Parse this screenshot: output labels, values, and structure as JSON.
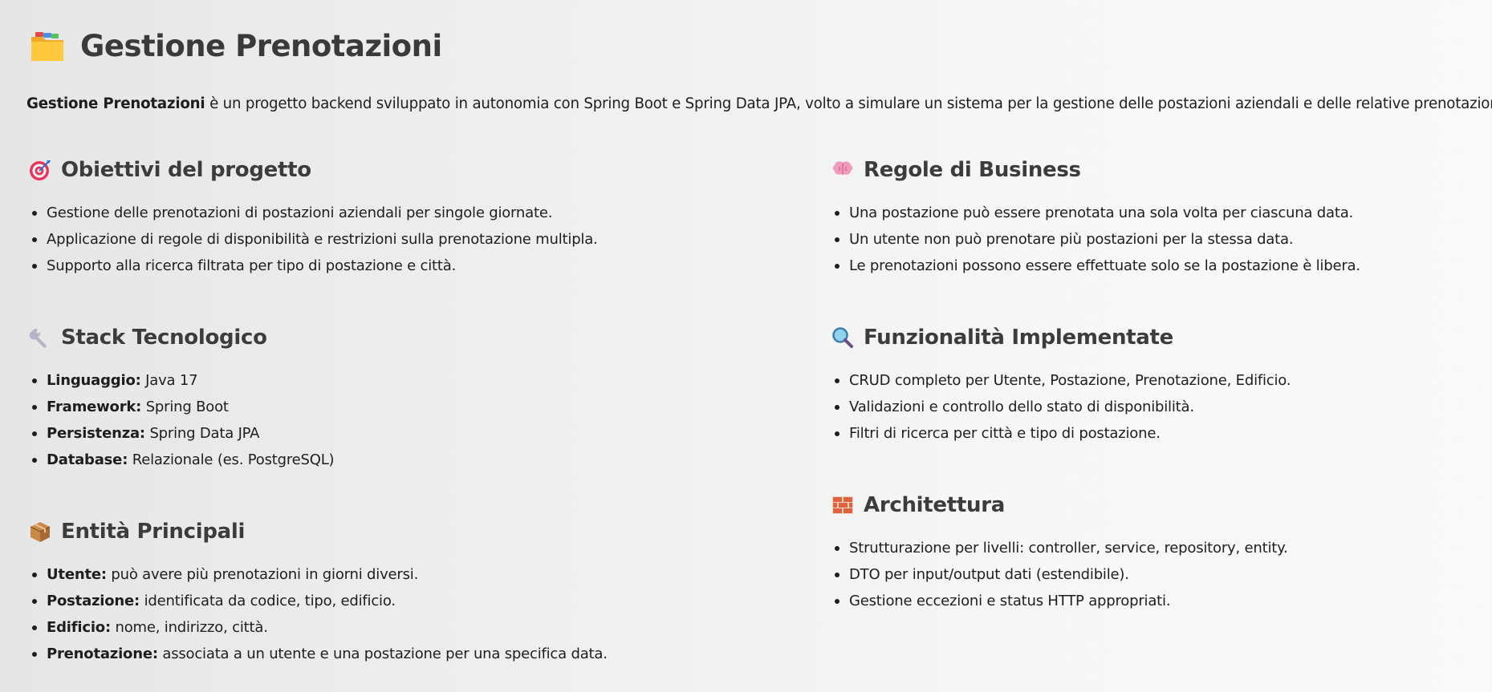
{
  "title": {
    "text": "Gestione Prenotazioni",
    "icon": "file-folder-icon"
  },
  "intro": {
    "bold": "Gestione Prenotazioni",
    "text": " è un progetto backend sviluppato in autonomia con Spring Boot e Spring Data JPA, volto a simulare un sistema per la gestione delle postazioni aziendali e delle relative prenotazioni."
  },
  "sections": {
    "obiettivi": {
      "icon": "target-icon",
      "heading": "Obiettivi del progetto",
      "items": [
        "Gestione delle prenotazioni di postazioni aziendali per singole giornate.",
        "Applicazione di regole di disponibilità e restrizioni sulla prenotazione multipla.",
        "Supporto alla ricerca filtrata per tipo di postazione e città."
      ]
    },
    "stack": {
      "icon": "wrench-icon",
      "heading": "Stack Tecnologico",
      "items": [
        {
          "label": "Linguaggio:",
          "value": " Java 17"
        },
        {
          "label": "Framework:",
          "value": " Spring Boot"
        },
        {
          "label": "Persistenza:",
          "value": " Spring Data JPA"
        },
        {
          "label": "Database:",
          "value": " Relazionale (es. PostgreSQL)"
        }
      ]
    },
    "entita": {
      "icon": "package-icon",
      "heading": "Entità Principali",
      "items": [
        {
          "label": "Utente:",
          "value": " può avere più prenotazioni in giorni diversi."
        },
        {
          "label": "Postazione:",
          "value": " identificata da codice, tipo, edificio."
        },
        {
          "label": "Edificio:",
          "value": " nome, indirizzo, città."
        },
        {
          "label": "Prenotazione:",
          "value": " associata a un utente e una postazione per una specifica data."
        }
      ]
    },
    "regole": {
      "icon": "brain-icon",
      "heading": "Regole di Business",
      "items": [
        "Una postazione può essere prenotata una sola volta per ciascuna data.",
        "Un utente non può prenotare più postazioni per la stessa data.",
        "Le prenotazioni possono essere effettuate solo se la postazione è libera."
      ]
    },
    "funzionalita": {
      "icon": "magnifying-glass-icon",
      "heading": "Funzionalità Implementate",
      "items": [
        "CRUD completo per Utente, Postazione, Prenotazione, Edificio.",
        "Validazioni e controllo dello stato di disponibilità.",
        "Filtri di ricerca per città e tipo di postazione."
      ]
    },
    "architettura": {
      "icon": "brick-icon",
      "heading": "Architettura",
      "items": [
        "Strutturazione per livelli: controller, service, repository, entity.",
        "DTO per input/output dati (estendibile).",
        "Gestione eccezioni e status HTTP appropriati."
      ]
    }
  }
}
